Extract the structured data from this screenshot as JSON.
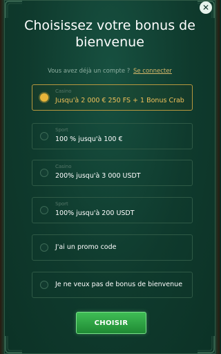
{
  "modal": {
    "title": "Choisissez votre bonus de bienvenue",
    "login_prompt": "Vous avez déjà un compte ?",
    "login_link": "Se connecter",
    "close_icon": "close-icon"
  },
  "options": [
    {
      "category": "Casino",
      "label": "Jusqu'à 2 000 € 250 FS + 1 Bonus Crab",
      "selected": true
    },
    {
      "category": "Sport",
      "label": "100 % jusqu'à 100 €",
      "selected": false
    },
    {
      "category": "Casino",
      "label": "200% jusqu'à 3 000 USDT",
      "selected": false
    },
    {
      "category": "Sport",
      "label": "100% jusqu'à 200 USDT",
      "selected": false
    },
    {
      "category": "",
      "label": "J'ai un promo code",
      "selected": false
    },
    {
      "category": "",
      "label": "Je ne veux pas de bonus de bienvenue",
      "selected": false
    }
  ],
  "actions": {
    "choose_label": "CHOISIR"
  },
  "colors": {
    "accent_gold": "#e7b53a",
    "button_green": "#2ea244",
    "background": "#0f3a2d"
  }
}
